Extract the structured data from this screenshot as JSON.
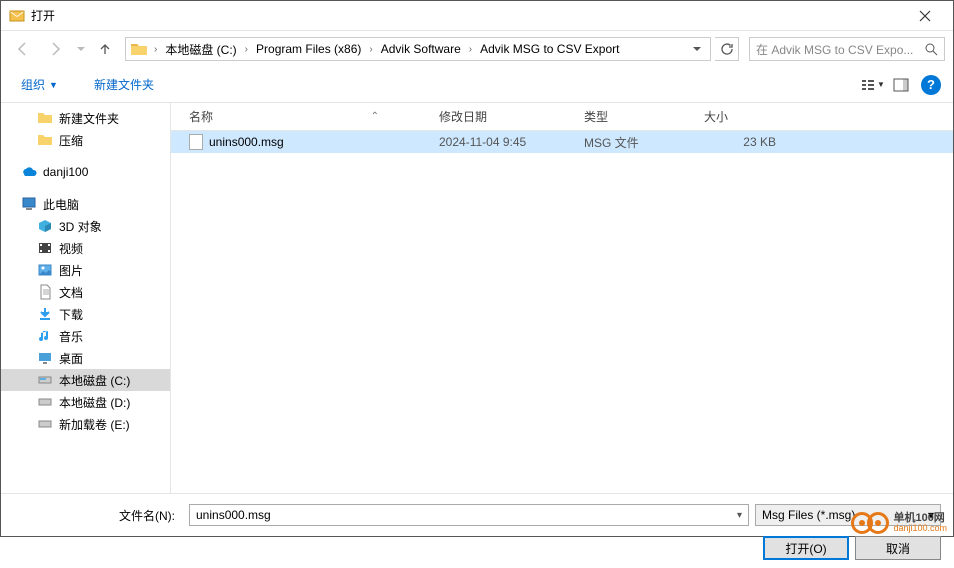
{
  "title": "打开",
  "breadcrumb": {
    "crumb1": "本地磁盘 (C:)",
    "crumb2": "Program Files (x86)",
    "crumb3": "Advik Software",
    "crumb4": "Advik MSG to CSV Export"
  },
  "search_placeholder": "在 Advik MSG to CSV Expo...",
  "toolbar": {
    "organize": "组织",
    "new_folder": "新建文件夹"
  },
  "columns": {
    "name": "名称",
    "date": "修改日期",
    "type": "类型",
    "size": "大小"
  },
  "sidebar": {
    "new_folder": "新建文件夹",
    "compressed": "压缩",
    "danji": "danji100",
    "this_pc": "此电脑",
    "objects3d": "3D 对象",
    "videos": "视频",
    "pictures": "图片",
    "documents": "文档",
    "downloads": "下载",
    "music": "音乐",
    "desktop": "桌面",
    "disk_c": "本地磁盘 (C:)",
    "disk_d": "本地磁盘 (D:)",
    "disk_e": "新加载卷 (E:)"
  },
  "file": {
    "name": "unins000.msg",
    "date": "2024-11-04 9:45",
    "type": "MSG 文件",
    "size": "23 KB"
  },
  "footer": {
    "filename_label": "文件名(N):",
    "filename_value": "unins000.msg",
    "filter": "Msg Files (*.msg)",
    "open": "打开(O)",
    "cancel": "取消"
  },
  "watermark": {
    "cn": "单机100网",
    "url": "danji100.com"
  }
}
